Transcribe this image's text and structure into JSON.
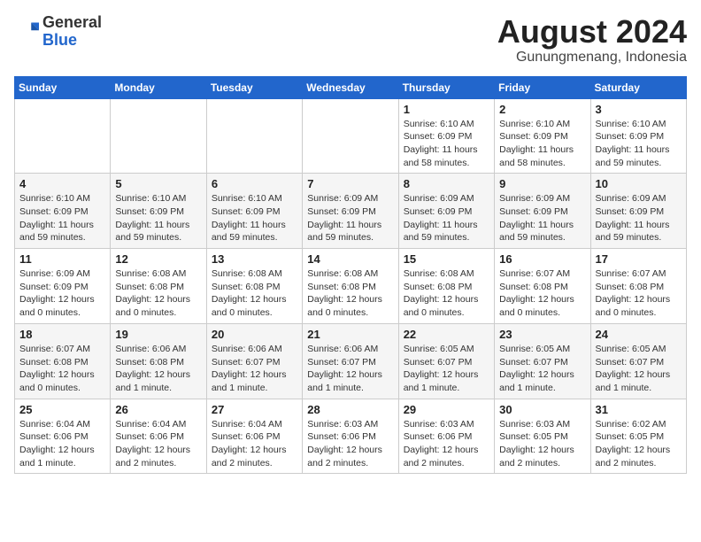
{
  "header": {
    "logo_general": "General",
    "logo_blue": "Blue",
    "month_year": "August 2024",
    "location": "Gunungmenang, Indonesia"
  },
  "weekdays": [
    "Sunday",
    "Monday",
    "Tuesday",
    "Wednesday",
    "Thursday",
    "Friday",
    "Saturday"
  ],
  "weeks": [
    [
      {
        "day": "",
        "info": ""
      },
      {
        "day": "",
        "info": ""
      },
      {
        "day": "",
        "info": ""
      },
      {
        "day": "",
        "info": ""
      },
      {
        "day": "1",
        "info": "Sunrise: 6:10 AM\nSunset: 6:09 PM\nDaylight: 11 hours\nand 58 minutes."
      },
      {
        "day": "2",
        "info": "Sunrise: 6:10 AM\nSunset: 6:09 PM\nDaylight: 11 hours\nand 58 minutes."
      },
      {
        "day": "3",
        "info": "Sunrise: 6:10 AM\nSunset: 6:09 PM\nDaylight: 11 hours\nand 59 minutes."
      }
    ],
    [
      {
        "day": "4",
        "info": "Sunrise: 6:10 AM\nSunset: 6:09 PM\nDaylight: 11 hours\nand 59 minutes."
      },
      {
        "day": "5",
        "info": "Sunrise: 6:10 AM\nSunset: 6:09 PM\nDaylight: 11 hours\nand 59 minutes."
      },
      {
        "day": "6",
        "info": "Sunrise: 6:10 AM\nSunset: 6:09 PM\nDaylight: 11 hours\nand 59 minutes."
      },
      {
        "day": "7",
        "info": "Sunrise: 6:09 AM\nSunset: 6:09 PM\nDaylight: 11 hours\nand 59 minutes."
      },
      {
        "day": "8",
        "info": "Sunrise: 6:09 AM\nSunset: 6:09 PM\nDaylight: 11 hours\nand 59 minutes."
      },
      {
        "day": "9",
        "info": "Sunrise: 6:09 AM\nSunset: 6:09 PM\nDaylight: 11 hours\nand 59 minutes."
      },
      {
        "day": "10",
        "info": "Sunrise: 6:09 AM\nSunset: 6:09 PM\nDaylight: 11 hours\nand 59 minutes."
      }
    ],
    [
      {
        "day": "11",
        "info": "Sunrise: 6:09 AM\nSunset: 6:09 PM\nDaylight: 12 hours\nand 0 minutes."
      },
      {
        "day": "12",
        "info": "Sunrise: 6:08 AM\nSunset: 6:08 PM\nDaylight: 12 hours\nand 0 minutes."
      },
      {
        "day": "13",
        "info": "Sunrise: 6:08 AM\nSunset: 6:08 PM\nDaylight: 12 hours\nand 0 minutes."
      },
      {
        "day": "14",
        "info": "Sunrise: 6:08 AM\nSunset: 6:08 PM\nDaylight: 12 hours\nand 0 minutes."
      },
      {
        "day": "15",
        "info": "Sunrise: 6:08 AM\nSunset: 6:08 PM\nDaylight: 12 hours\nand 0 minutes."
      },
      {
        "day": "16",
        "info": "Sunrise: 6:07 AM\nSunset: 6:08 PM\nDaylight: 12 hours\nand 0 minutes."
      },
      {
        "day": "17",
        "info": "Sunrise: 6:07 AM\nSunset: 6:08 PM\nDaylight: 12 hours\nand 0 minutes."
      }
    ],
    [
      {
        "day": "18",
        "info": "Sunrise: 6:07 AM\nSunset: 6:08 PM\nDaylight: 12 hours\nand 0 minutes."
      },
      {
        "day": "19",
        "info": "Sunrise: 6:06 AM\nSunset: 6:08 PM\nDaylight: 12 hours\nand 1 minute."
      },
      {
        "day": "20",
        "info": "Sunrise: 6:06 AM\nSunset: 6:07 PM\nDaylight: 12 hours\nand 1 minute."
      },
      {
        "day": "21",
        "info": "Sunrise: 6:06 AM\nSunset: 6:07 PM\nDaylight: 12 hours\nand 1 minute."
      },
      {
        "day": "22",
        "info": "Sunrise: 6:05 AM\nSunset: 6:07 PM\nDaylight: 12 hours\nand 1 minute."
      },
      {
        "day": "23",
        "info": "Sunrise: 6:05 AM\nSunset: 6:07 PM\nDaylight: 12 hours\nand 1 minute."
      },
      {
        "day": "24",
        "info": "Sunrise: 6:05 AM\nSunset: 6:07 PM\nDaylight: 12 hours\nand 1 minute."
      }
    ],
    [
      {
        "day": "25",
        "info": "Sunrise: 6:04 AM\nSunset: 6:06 PM\nDaylight: 12 hours\nand 1 minute."
      },
      {
        "day": "26",
        "info": "Sunrise: 6:04 AM\nSunset: 6:06 PM\nDaylight: 12 hours\nand 2 minutes."
      },
      {
        "day": "27",
        "info": "Sunrise: 6:04 AM\nSunset: 6:06 PM\nDaylight: 12 hours\nand 2 minutes."
      },
      {
        "day": "28",
        "info": "Sunrise: 6:03 AM\nSunset: 6:06 PM\nDaylight: 12 hours\nand 2 minutes."
      },
      {
        "day": "29",
        "info": "Sunrise: 6:03 AM\nSunset: 6:06 PM\nDaylight: 12 hours\nand 2 minutes."
      },
      {
        "day": "30",
        "info": "Sunrise: 6:03 AM\nSunset: 6:05 PM\nDaylight: 12 hours\nand 2 minutes."
      },
      {
        "day": "31",
        "info": "Sunrise: 6:02 AM\nSunset: 6:05 PM\nDaylight: 12 hours\nand 2 minutes."
      }
    ]
  ]
}
